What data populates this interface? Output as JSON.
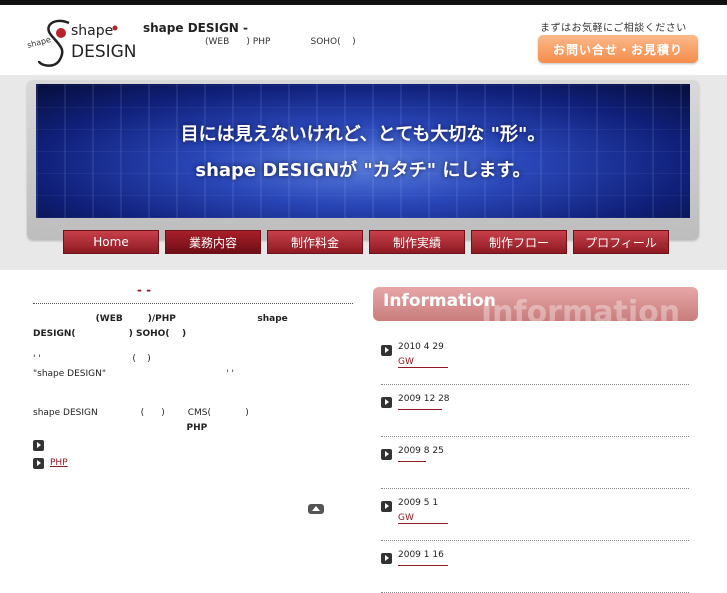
{
  "header": {
    "logo_text_top": "shape",
    "logo_text_bottom": "DESIGN",
    "logo_text_side": "shape",
    "site_title": "shape DESIGN -",
    "site_subtitle": "(WEB      ) PHP              SOHO(    )",
    "contact_note": "まずはお気軽にご相談ください",
    "contact_button": "お問い合せ・お見積り"
  },
  "banner": {
    "line1": "目には見えないけれど、とても大切な \"形\"。",
    "line2": "shape DESIGNが \"カタチ\" にします。"
  },
  "nav": {
    "items": [
      {
        "label": "Home"
      },
      {
        "label": "業務内容"
      },
      {
        "label": "制作料金"
      },
      {
        "label": "制作実績"
      },
      {
        "label": "制作フロー"
      },
      {
        "label": "プロフィール"
      }
    ]
  },
  "main": {
    "heading": "- -",
    "para1_line1": "                    (WEB        )/PHP                          shape",
    "para1_line2_bold": "DESIGN(",
    "para1_line2_rest": "                 ) SOHO(    )",
    "para2_line1": "' '                                (    )",
    "para2_line2": "\"shape DESIGN\"                                          ' '",
    "para3_line1": "shape DESIGN               (      )        CMS(            )",
    "para3_line2": "                                                 PHP",
    "link1": "",
    "link2": "PHP",
    "pagetop_link": ""
  },
  "info": {
    "title": "Information",
    "ghost": "Information",
    "news": [
      {
        "date": "2010 4 29",
        "link": "GW"
      },
      {
        "date": "2009 12 28",
        "link": ""
      },
      {
        "date": "2009 8 25",
        "link": ""
      },
      {
        "date": "2009 5 1",
        "link": "GW"
      },
      {
        "date": "2009 1 16",
        "link": ""
      }
    ]
  }
}
